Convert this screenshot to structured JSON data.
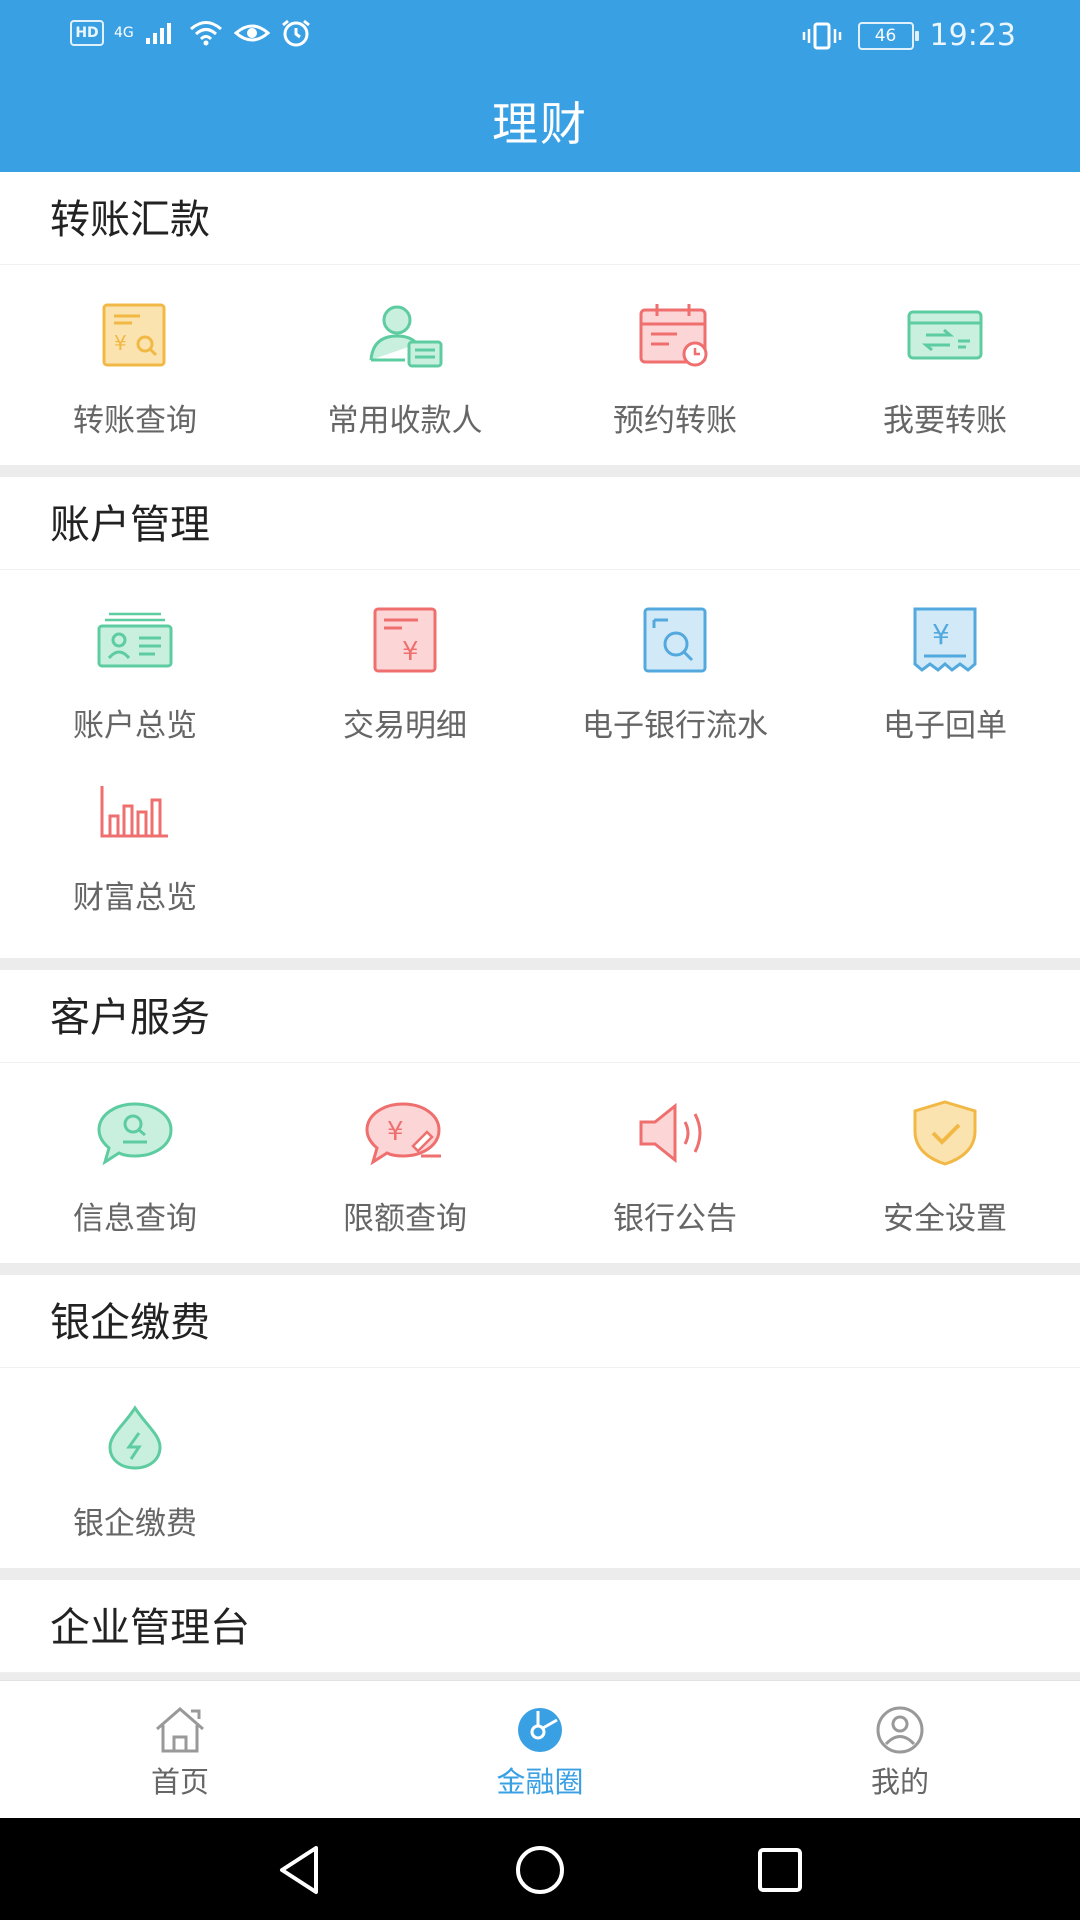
{
  "status_bar": {
    "hd": "HD",
    "network": "4G",
    "battery": "46",
    "time": "19:23"
  },
  "header": {
    "title": "理财"
  },
  "sections": [
    {
      "title": "转账汇款",
      "items": [
        {
          "label": "转账查询",
          "icon": "transfer-query-icon"
        },
        {
          "label": "常用收款人",
          "icon": "payee-icon"
        },
        {
          "label": "预约转账",
          "icon": "scheduled-transfer-icon"
        },
        {
          "label": "我要转账",
          "icon": "transfer-card-icon"
        }
      ]
    },
    {
      "title": "账户管理",
      "items": [
        {
          "label": "账户总览",
          "icon": "account-card-icon"
        },
        {
          "label": "交易明细",
          "icon": "transaction-detail-icon"
        },
        {
          "label": "电子银行流水",
          "icon": "bank-statement-icon"
        },
        {
          "label": "电子回单",
          "icon": "receipt-icon"
        },
        {
          "label": "财富总览",
          "icon": "wealth-chart-icon"
        }
      ]
    },
    {
      "title": "客户服务",
      "items": [
        {
          "label": "信息查询",
          "icon": "info-chat-icon"
        },
        {
          "label": "限额查询",
          "icon": "limit-query-icon"
        },
        {
          "label": "银行公告",
          "icon": "speaker-icon"
        },
        {
          "label": "安全设置",
          "icon": "shield-check-icon"
        }
      ]
    },
    {
      "title": "银企缴费",
      "items": [
        {
          "label": "银企缴费",
          "icon": "water-drop-icon"
        }
      ]
    },
    {
      "title": "企业管理台",
      "items": []
    }
  ],
  "tabbar": [
    {
      "label": "首页",
      "icon": "home-icon"
    },
    {
      "label": "金融圈",
      "icon": "finance-circle-icon",
      "active": true
    },
    {
      "label": "我的",
      "icon": "profile-icon"
    }
  ],
  "colors": {
    "header": "#3aa0e4",
    "green": "#5dcca0",
    "red": "#ef6f6f",
    "orange": "#f2b845",
    "blue": "#53a9de"
  }
}
